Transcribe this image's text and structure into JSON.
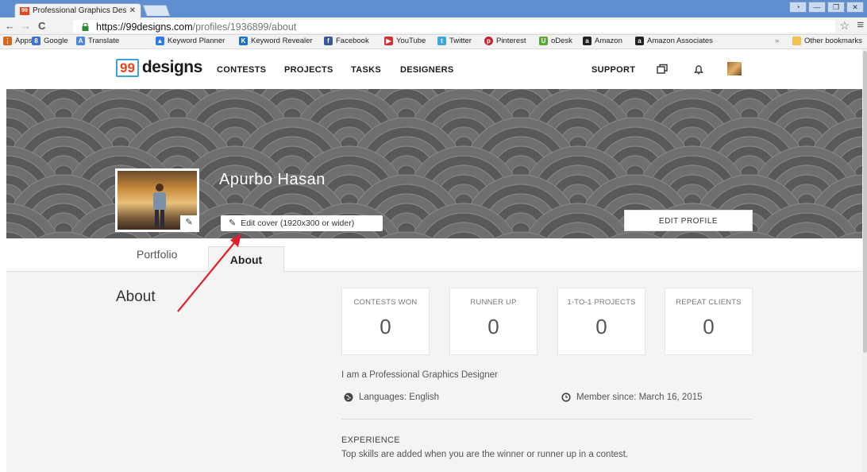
{
  "browser": {
    "tab_title": "Professional Graphics Des",
    "tab_favicon": "99",
    "url_scheme": "https://",
    "url_host": "99designs.com",
    "url_path": "/profiles/1936899/about",
    "bookmarks": [
      "Apps",
      "Google",
      "Translate",
      "Keyword Planner",
      "Keyword Revealer",
      "Facebook",
      "YouTube",
      "Twitter",
      "Pinterest",
      "oDesk",
      "Amazon",
      "Amazon Associates"
    ],
    "bookmarks_overflow": "»",
    "other_bookmarks": "Other bookmarks",
    "icons": [
      "back-icon",
      "forward-icon",
      "reload-icon",
      "lock-icon",
      "star-icon",
      "menu-icon"
    ]
  },
  "site": {
    "logo_num": "99",
    "logo_word": "designs",
    "nav": [
      "CONTESTS",
      "PROJECTS",
      "TASKS",
      "DESIGNERS"
    ],
    "support": "SUPPORT",
    "icons": [
      "messages-icon",
      "bell-icon",
      "user-avatar"
    ]
  },
  "profile": {
    "name": "Apurbo Hasan",
    "edit_cover": "Edit cover (1920x300 or wider)",
    "edit_profile": "EDIT PROFILE",
    "tabs": [
      "Portfolio",
      "About"
    ],
    "active_tab": "About"
  },
  "about": {
    "heading": "About",
    "stats": [
      {
        "label": "CONTESTS WON",
        "value": "0"
      },
      {
        "label": "RUNNER UP",
        "value": "0"
      },
      {
        "label": "1-TO-1 PROJECTS",
        "value": "0"
      },
      {
        "label": "REPEAT CLIENTS",
        "value": "0"
      }
    ],
    "bio": "I am a Professional Graphics Designer",
    "languages": "Languages: English",
    "member_since": "Member since: March 16, 2015",
    "experience_heading": "EXPERIENCE",
    "experience_note": "Top skills are added when you are the winner or runner up in a contest."
  },
  "colors": {
    "brand_orange": "#e8441f",
    "brand_blue": "#3ea0df",
    "annotation_red": "#e0202a",
    "cover_gray": "#5c5c5c"
  }
}
